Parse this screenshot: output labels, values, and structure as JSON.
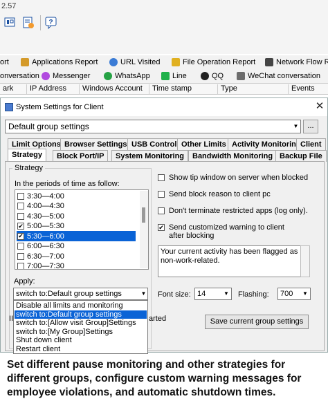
{
  "version": "2.57",
  "toolbar": {
    "icons": [
      "device-icon",
      "report-icon",
      "help-icon"
    ]
  },
  "background_tabs_row1": [
    {
      "label": "ort",
      "icon": "generic-icon"
    },
    {
      "label": "Applications Report",
      "icon": "report-icon"
    },
    {
      "label": "URL Visited",
      "icon": "globe-icon"
    },
    {
      "label": "File Operation Report",
      "icon": "file-icon"
    },
    {
      "label": "Network Flow R",
      "icon": "network-icon"
    }
  ],
  "background_tabs_row2": [
    {
      "label": "onversation",
      "icon": ""
    },
    {
      "label": "Messenger",
      "icon": "messenger-icon"
    },
    {
      "label": "WhatsApp",
      "icon": "whatsapp-icon"
    },
    {
      "label": "Line",
      "icon": "line-icon"
    },
    {
      "label": "QQ",
      "icon": "qq-icon"
    },
    {
      "label": "WeChat conversation",
      "icon": "wechat-icon"
    }
  ],
  "background_columns": [
    "ark",
    "IP Address",
    "Windows Account",
    "Time stamp",
    "Type",
    "Events"
  ],
  "dialog": {
    "title": "System Settings for Client",
    "close": "✕",
    "group_select": "Default group settings",
    "dots_button": "...",
    "tabs_row1": [
      "Limit Options",
      "Browser Settings",
      "USB Control",
      "Other Limits",
      "Activity Monitoring",
      "Client"
    ],
    "tabs_row2": [
      "Strategy",
      "Block Port/IP",
      "System Monitoring",
      "Bandwidth Monitoring",
      "Backup File"
    ],
    "active_tab": "Strategy",
    "strategy_legend": "Strategy",
    "periods_label": "In the periods of time as follow:",
    "periods": [
      {
        "label": "3:30—4:00",
        "checked": false,
        "selected": false
      },
      {
        "label": "4:00—4:30",
        "checked": false,
        "selected": false
      },
      {
        "label": "4:30—5:00",
        "checked": false,
        "selected": false
      },
      {
        "label": "5:00—5:30",
        "checked": true,
        "selected": false
      },
      {
        "label": "5:30—6:00",
        "checked": true,
        "selected": true
      },
      {
        "label": "6:00—6:30",
        "checked": false,
        "selected": false
      },
      {
        "label": "6:30—7:00",
        "checked": false,
        "selected": false
      },
      {
        "label": "7:00—7:30",
        "checked": false,
        "selected": false
      }
    ],
    "apply_label": "Apply:",
    "apply_selected": "switch to:Default group settings",
    "apply_options": [
      {
        "label": "Disable all limits and monitoring",
        "selected": false
      },
      {
        "label": "switch to:Default group settings",
        "selected": true
      },
      {
        "label": "switch to:[Allow visit Group]Settings",
        "selected": false
      },
      {
        "label": "switch to:[My Group]Settings",
        "selected": false
      },
      {
        "label": "Shut down client",
        "selected": false
      },
      {
        "label": "Restart client",
        "selected": false
      }
    ],
    "hidden_text_left": "II",
    "hidden_text_right": "arted",
    "options": [
      {
        "label": "Show tip window on server when blocked",
        "checked": false
      },
      {
        "label": "Send block reason to client pc",
        "checked": false
      },
      {
        "label": "Don't terminate restricted apps (log only).",
        "checked": false
      },
      {
        "label": "Send customized warning to client after blocking",
        "checked": true
      }
    ],
    "warning_message": "Your current activity has been flagged as non-work-related.",
    "font_size_label": "Font size:",
    "font_size_value": "14",
    "flashing_label": "Flashing:",
    "flashing_value": "700",
    "save_button": "Save current group settings"
  },
  "caption": "Set different pause monitoring and other strategies for different groups, configure custom warning messages for employee violations, and automatic shutdown times.",
  "colors": {
    "selection": "#0a63d6",
    "dialog_bg": "#f0f0f0"
  }
}
